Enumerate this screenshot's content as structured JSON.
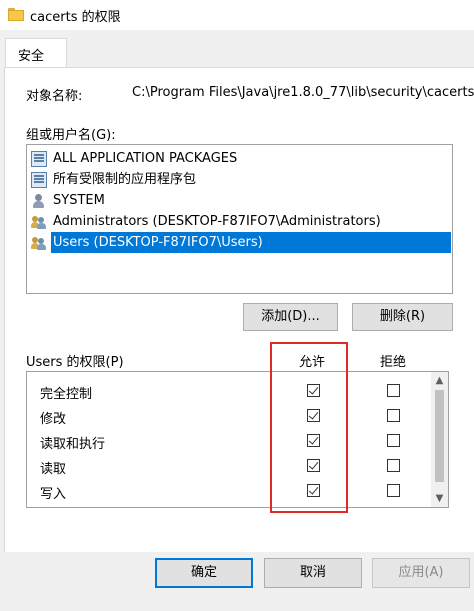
{
  "window": {
    "title": "cacerts 的权限"
  },
  "tabs": [
    {
      "label": "安全"
    }
  ],
  "object": {
    "label": "对象名称:",
    "value": "C:\\Program Files\\Java\\jre1.8.0_77\\lib\\security\\cacerts"
  },
  "groups": {
    "label": "组或用户名(G):",
    "items": [
      {
        "name": "ALL APPLICATION PACKAGES",
        "icon": "app-package-icon",
        "selected": false
      },
      {
        "name": "所有受限制的应用程序包",
        "icon": "app-package-icon",
        "selected": false
      },
      {
        "name": "SYSTEM",
        "icon": "user-icon",
        "selected": false
      },
      {
        "name": "Administrators (DESKTOP-F87IFO7\\Administrators)",
        "icon": "users-group-icon",
        "selected": false
      },
      {
        "name": "Users (DESKTOP-F87IFO7\\Users)",
        "icon": "users-group-icon",
        "selected": true
      }
    ],
    "add_label": "添加(D)...",
    "remove_label": "删除(R)"
  },
  "permissions": {
    "label": "Users 的权限(P)",
    "allow_header": "允许",
    "deny_header": "拒绝",
    "rows": [
      {
        "name": "完全控制",
        "allow": true,
        "deny": false
      },
      {
        "name": "修改",
        "allow": true,
        "deny": false
      },
      {
        "name": "读取和执行",
        "allow": true,
        "deny": false
      },
      {
        "name": "读取",
        "allow": true,
        "deny": false
      },
      {
        "name": "写入",
        "allow": true,
        "deny": false
      }
    ]
  },
  "footer": {
    "ok_label": "确定",
    "cancel_label": "取消",
    "apply_label": "应用(A)"
  },
  "colors": {
    "selection": "#0078d7",
    "highlight_box": "#e02a2a"
  }
}
